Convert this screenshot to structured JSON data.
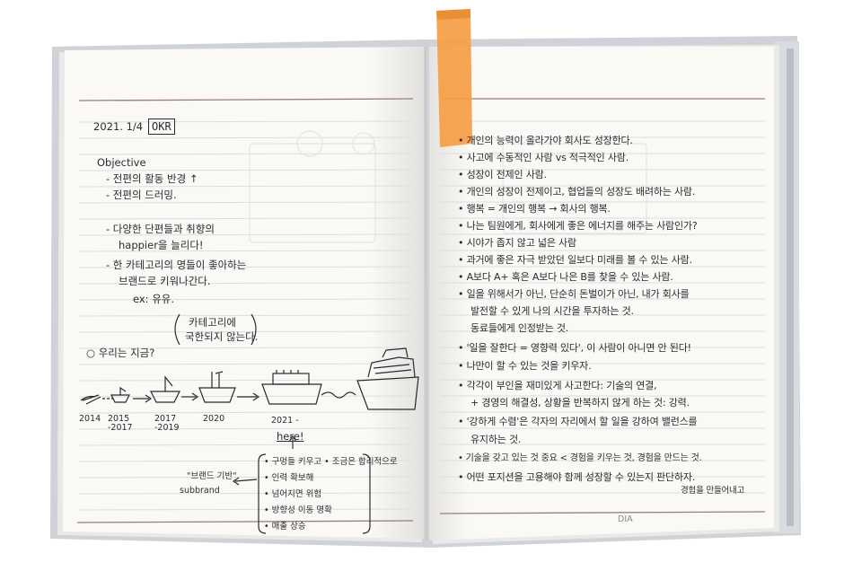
{
  "left_page": {
    "date": "2021. 1/4",
    "tag": "OKR",
    "objective_heading": "Objective",
    "objective_items": [
      "- 전편의 활동 반경 ↑",
      "- 전편의 드러밍."
    ],
    "notes": [
      "- 다양한 단편들과 취향의",
      "happier을 늘리다!",
      "- 한 카테고리의 명들이 좋아하는",
      "브랜드로 키워나간다.",
      "ex: 유유."
    ],
    "callout": [
      "카테고리에",
      "국한되지 않는다."
    ],
    "section_label": "○ 우리는 지금?",
    "timeline_years": [
      "2014",
      "2015\n-2017",
      "2017\n-2019",
      "2020",
      "2021 -"
    ],
    "here_label": "here!",
    "subbrand_label": [
      "\"브랜드 기반\"",
      "subbrand"
    ],
    "bracket_items": [
      "• 구멍들 키우고 • 조금은 합리적으로",
      "• 인력 확보해",
      "• 넘어지면 위험",
      "• 방향성 이동 명확",
      "• 매출 상승"
    ]
  },
  "right_page": {
    "lines": [
      "• 개인의 능력이 올라가야 회사도 성장한다.",
      "• 사고에 수동적인 사람 vs 적극적인 사람.",
      "• 성장이 전제인 사람.",
      "• 개인의 성장이 전제이고, 협업들의 성장도 배려하는 사람.",
      "• 행복 = 개인의 행복 → 회사의 행복.",
      "• 나는 팀원에게, 회사에게 좋은 에너지를 해주는 사람인가?",
      "• 시야가 좁지 않고 넓은 사람",
      "• 과거에 좋은 자극 받았던 일보다 미래를 볼 수 있는 사람.",
      "• A보다 A+ 혹은 A보다 나은 B를 찾을 수 있는 사람.",
      "• 일을 위해서가 아닌, 단순히 돈벌이가 아닌, 내가 회사를",
      "발전할 수 있게 나의 시간을 투자하는 것.",
      "동료들에게 인정받는 것.",
      "• '일을 잘한다 = 영향력 있다', 이 사람이 아니면 안 된다!",
      "• 나만이 할 수 있는 것을 키우자.",
      "• 각각이 부인을 재미있게 사고한다: 기술의 연결,",
      "+ 경영의 해결성, 상황을 반복하지 않게 하는 것: 강력.",
      "• '강하게 수렴'은 각자의 자리에서 할 일을 강하여 밸런스를",
      "유지하는 것.",
      "• 기술을 갖고 있는 것 중요 < 경험을 키우는 것, 경험을 만드는 것.",
      "• 어떤 포지션을 고용해야 함께 성장할 수 있는지 판단하자.",
      "경험을 만들어내고"
    ],
    "footer_mark": "DIA"
  },
  "colors": {
    "tape": "#f6a04a",
    "page": "#faf9f6",
    "rule": "#dcdde2",
    "header_rule": "#9a7f73",
    "ink": "#2a2a2e"
  }
}
